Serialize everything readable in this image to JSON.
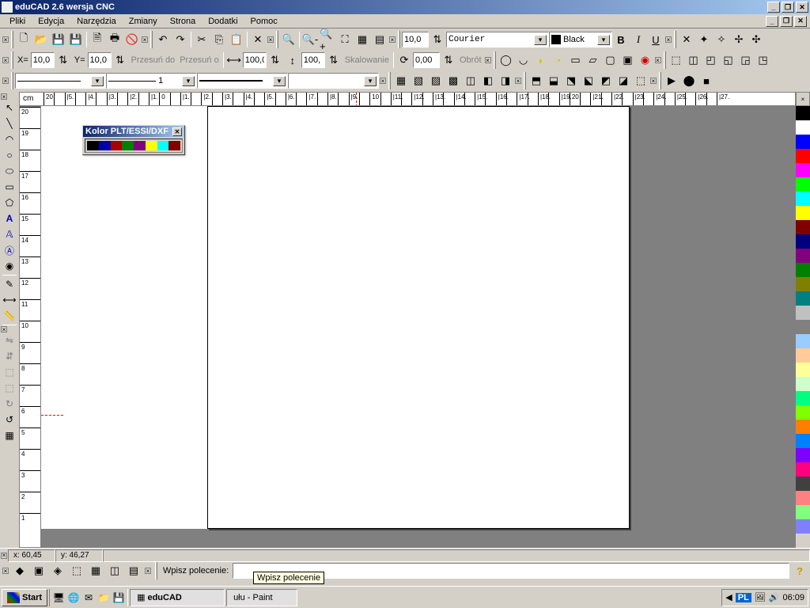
{
  "title": "eduCAD 2.6 wersja CNC",
  "menu": [
    "Pliki",
    "Edycja",
    "Narzędzia",
    "Zmiany",
    "Strona",
    "Dodatki",
    "Pomoc"
  ],
  "toolbar1": {
    "font_size": "10,0",
    "font": "Courier",
    "color": "Black"
  },
  "coords": {
    "x_label": "X=",
    "x": "10,0",
    "y_label": "Y=",
    "y": "10,0",
    "przesun_do": "Przesuń do",
    "przesun_o": "Przesuń o",
    "w1": "100,0",
    "w2": "100,",
    "skalowanie": "Skalowanie",
    "rot": "0,00",
    "obrot": "Obrót"
  },
  "style_row": {
    "line1": "",
    "line2": "1",
    "line3": "",
    "line4": ""
  },
  "ruler_unit": "cm",
  "h_ticks_left": [
    "20",
    "..",
    "|5.",
    "..",
    "|4.",
    "..",
    "|3.",
    "..",
    "|2.",
    "..",
    "|1."
  ],
  "h_ticks_right": [
    "0",
    "..",
    "|1.",
    "..",
    "|2.",
    "..",
    "|3.",
    "..",
    "|4.",
    "..",
    "|5.",
    "..",
    "|6.",
    "..",
    "|7.",
    "..",
    "|8.",
    "..",
    "|9.",
    "..",
    "10",
    "..",
    "|11.",
    "..",
    "|12.",
    "..",
    "|13.",
    "..",
    "|14.",
    "..",
    "|15.",
    "..",
    "|16.",
    "..",
    "|17.",
    "..",
    "|18.",
    "..",
    "|19.",
    "20",
    "..",
    "|21.",
    "..",
    "|22.",
    "..",
    "|23.",
    "..",
    "|24.",
    "..",
    "|25.",
    "..",
    "|26.",
    "..",
    "|27."
  ],
  "v_ticks": [
    "20",
    "19",
    "18",
    "17",
    "16",
    "15",
    "14",
    "13",
    "12",
    "11",
    "10",
    "9",
    "8",
    "7",
    "6",
    "5",
    "4",
    "3",
    "2",
    "1"
  ],
  "floating": {
    "title": "Kolor PLT/ESSI/DXF",
    "colors": [
      "#000000",
      "#0000aa",
      "#aa0000",
      "#008000",
      "#800080",
      "#ffff00",
      "#00ffff",
      "#800000"
    ]
  },
  "palette": [
    "#000000",
    "#ffffff",
    "#0000ff",
    "#ff0000",
    "#ff00ff",
    "#00ff00",
    "#00ffff",
    "#ffff00",
    "#800000",
    "#000080",
    "#800080",
    "#008000",
    "#808000",
    "#008080",
    "#c0c0c0",
    "#808080",
    "#99ccff",
    "#ffcc99",
    "#ffff99",
    "#ccffcc",
    "#00ff80",
    "#80ff00",
    "#ff8000",
    "#0080ff",
    "#8000ff",
    "#ff0080",
    "#404040",
    "#ff8080",
    "#80ff80",
    "#8080ff"
  ],
  "status": {
    "x": "x: 60,45",
    "y": "y: 46,27"
  },
  "command": {
    "label": "Wpisz polecenie:",
    "value": ""
  },
  "tooltip": "Wpisz polecenie",
  "taskbar": {
    "start": "Start",
    "app1": "eduCAD",
    "app2": "ułu - Paint",
    "lang": "PL",
    "clock": "06:09"
  }
}
